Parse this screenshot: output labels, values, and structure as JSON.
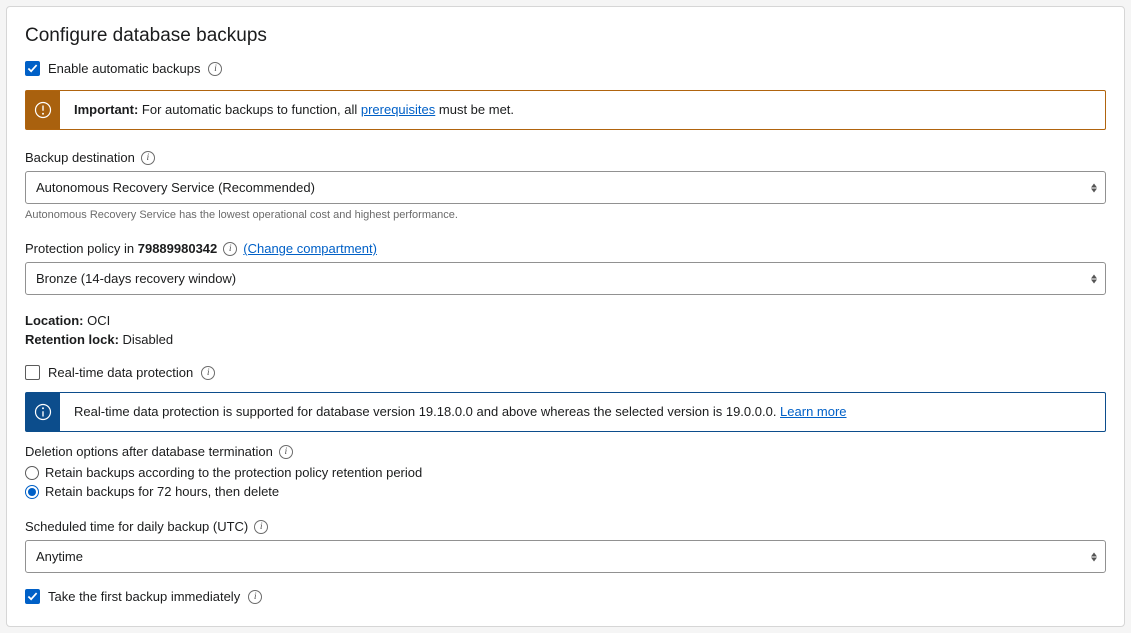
{
  "panel": {
    "title": "Configure database backups"
  },
  "enableAutoBackups": {
    "label": "Enable automatic backups"
  },
  "importantAlert": {
    "prefix": "Important:",
    "text1": " For automatic backups to function, all ",
    "link": "prerequisites",
    "text2": " must be met."
  },
  "backupDestination": {
    "label": "Backup destination",
    "value": "Autonomous Recovery Service (Recommended)",
    "help": "Autonomous Recovery Service has the lowest operational cost and highest performance."
  },
  "protectionPolicy": {
    "labelPrefix": "Protection policy in ",
    "compartment": "79889980342",
    "changeLink": "(Change compartment)",
    "value": "Bronze (14-days recovery window)"
  },
  "location": {
    "label": "Location:",
    "value": " OCI"
  },
  "retentionLock": {
    "label": "Retention lock:",
    "value": " Disabled"
  },
  "realtime": {
    "label": "Real-time data protection"
  },
  "realtimeAlert": {
    "text": "Real-time data protection is supported for database version 19.18.0.0 and above whereas the selected version is 19.0.0.0. ",
    "link": "Learn more"
  },
  "deletionOptions": {
    "label": "Deletion options after database termination",
    "opt1": "Retain backups according to the protection policy retention period",
    "opt2": "Retain backups for 72 hours, then delete"
  },
  "scheduledTime": {
    "label": "Scheduled time for daily backup (UTC)",
    "value": "Anytime"
  },
  "firstBackup": {
    "label": "Take the first backup immediately"
  }
}
